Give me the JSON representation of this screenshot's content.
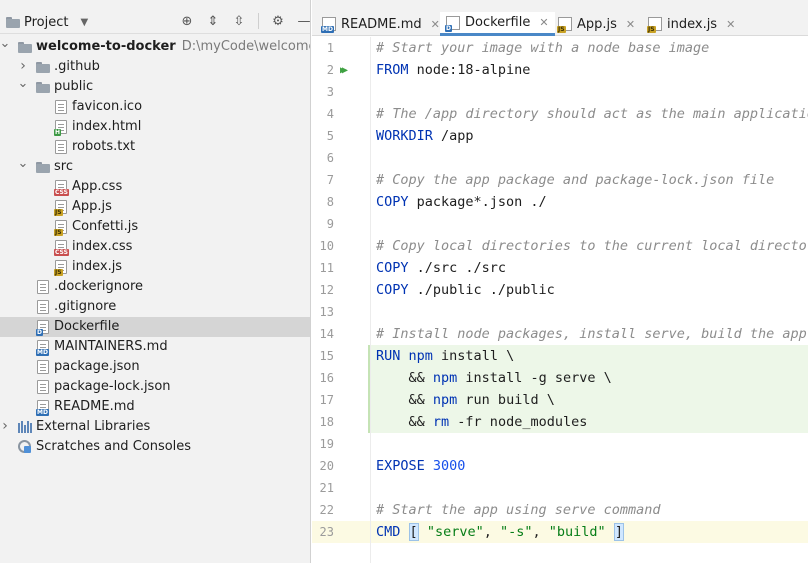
{
  "project_panel": {
    "title": "Project",
    "tree": [
      {
        "label": "welcome-to-docker",
        "path": "D:\\myCode\\welcome-t",
        "type": "folder",
        "depth": 0,
        "expanded": true,
        "bold": true
      },
      {
        "label": ".github",
        "type": "folder",
        "depth": 1,
        "expanded": false
      },
      {
        "label": "public",
        "type": "folder",
        "depth": 1,
        "expanded": true
      },
      {
        "label": "favicon.ico",
        "type": "file",
        "depth": 2,
        "badge": ""
      },
      {
        "label": "index.html",
        "type": "file",
        "depth": 2,
        "badge": "H"
      },
      {
        "label": "robots.txt",
        "type": "file",
        "depth": 2,
        "badge": ""
      },
      {
        "label": "src",
        "type": "folder",
        "depth": 1,
        "expanded": true
      },
      {
        "label": "App.css",
        "type": "file",
        "depth": 2,
        "badge": "CSS"
      },
      {
        "label": "App.js",
        "type": "file",
        "depth": 2,
        "badge": "JS"
      },
      {
        "label": "Confetti.js",
        "type": "file",
        "depth": 2,
        "badge": "JS"
      },
      {
        "label": "index.css",
        "type": "file",
        "depth": 2,
        "badge": "CSS"
      },
      {
        "label": "index.js",
        "type": "file",
        "depth": 2,
        "badge": "JS"
      },
      {
        "label": ".dockerignore",
        "type": "file",
        "depth": 1,
        "badge": ""
      },
      {
        "label": ".gitignore",
        "type": "file",
        "depth": 1,
        "badge": ""
      },
      {
        "label": "Dockerfile",
        "type": "file",
        "depth": 1,
        "badge": "D",
        "selected": true
      },
      {
        "label": "MAINTAINERS.md",
        "type": "file",
        "depth": 1,
        "badge": "MD"
      },
      {
        "label": "package.json",
        "type": "file",
        "depth": 1,
        "badge": ""
      },
      {
        "label": "package-lock.json",
        "type": "file",
        "depth": 1,
        "badge": ""
      },
      {
        "label": "README.md",
        "type": "file",
        "depth": 1,
        "badge": "MD"
      },
      {
        "label": "External Libraries",
        "type": "library",
        "depth": 0,
        "expanded": false
      },
      {
        "label": "Scratches and Consoles",
        "type": "scratch",
        "depth": 0
      }
    ]
  },
  "tabs": [
    {
      "label": "README.md",
      "badge": "MD",
      "active": false,
      "closable": true
    },
    {
      "label": "Dockerfile",
      "badge": "D",
      "active": true,
      "closable": true
    },
    {
      "label": "App.js",
      "badge": "JS",
      "active": false,
      "closable": true
    },
    {
      "label": "index.js",
      "badge": "JS",
      "active": false,
      "closable": true
    }
  ],
  "editor": {
    "lines": [
      {
        "n": "1",
        "tokens": [
          [
            "comment",
            "# Start your image with a node base image"
          ]
        ]
      },
      {
        "n": "2",
        "run": true,
        "tokens": [
          [
            "kw",
            "FROM"
          ],
          [
            "text",
            " node:18-alpine"
          ]
        ]
      },
      {
        "n": "3",
        "tokens": []
      },
      {
        "n": "4",
        "tokens": [
          [
            "comment",
            "# The /app directory should act as the main applicatio"
          ]
        ]
      },
      {
        "n": "5",
        "tokens": [
          [
            "kw",
            "WORKDIR"
          ],
          [
            "text",
            " /app"
          ]
        ]
      },
      {
        "n": "6",
        "tokens": []
      },
      {
        "n": "7",
        "tokens": [
          [
            "comment",
            "# Copy the app package and package-lock.json file"
          ]
        ]
      },
      {
        "n": "8",
        "tokens": [
          [
            "kw",
            "COPY"
          ],
          [
            "text",
            " package*.json ./"
          ]
        ]
      },
      {
        "n": "9",
        "tokens": []
      },
      {
        "n": "10",
        "tokens": [
          [
            "comment",
            "# Copy local directories to the current local director"
          ]
        ]
      },
      {
        "n": "11",
        "tokens": [
          [
            "kw",
            "COPY"
          ],
          [
            "text",
            " ./src ./src"
          ]
        ]
      },
      {
        "n": "12",
        "tokens": [
          [
            "kw",
            "COPY"
          ],
          [
            "text",
            " ./public ./public"
          ]
        ]
      },
      {
        "n": "13",
        "tokens": []
      },
      {
        "n": "14",
        "tokens": [
          [
            "comment",
            "# Install node packages, install serve, build the app,"
          ]
        ]
      },
      {
        "n": "15",
        "hl": "green",
        "tokens": [
          [
            "kw",
            "RUN"
          ],
          [
            "text",
            " "
          ],
          [
            "kw",
            "npm"
          ],
          [
            "text",
            " install \\"
          ]
        ]
      },
      {
        "n": "16",
        "hl": "green",
        "tokens": [
          [
            "text",
            "    && "
          ],
          [
            "kw",
            "npm"
          ],
          [
            "text",
            " install -g serve \\"
          ]
        ]
      },
      {
        "n": "17",
        "hl": "green",
        "tokens": [
          [
            "text",
            "    && "
          ],
          [
            "kw",
            "npm"
          ],
          [
            "text",
            " run build \\"
          ]
        ]
      },
      {
        "n": "18",
        "hl": "green",
        "tokens": [
          [
            "text",
            "    && "
          ],
          [
            "kw",
            "rm"
          ],
          [
            "text",
            " -fr node_modules"
          ]
        ]
      },
      {
        "n": "19",
        "tokens": []
      },
      {
        "n": "20",
        "tokens": [
          [
            "kw",
            "EXPOSE"
          ],
          [
            "text",
            " "
          ],
          [
            "num",
            "3000"
          ]
        ]
      },
      {
        "n": "21",
        "tokens": []
      },
      {
        "n": "22",
        "tokens": [
          [
            "comment",
            "# Start the app using serve command"
          ]
        ]
      },
      {
        "n": "23",
        "hl": "caret",
        "tokens": [
          [
            "kw",
            "CMD"
          ],
          [
            "text",
            " "
          ],
          [
            "bracket",
            "["
          ],
          [
            "text",
            " "
          ],
          [
            "str",
            "\"serve\""
          ],
          [
            "text",
            ", "
          ],
          [
            "str",
            "\"-s\""
          ],
          [
            "text",
            ", "
          ],
          [
            "str",
            "\"build\""
          ],
          [
            "text",
            " "
          ],
          [
            "bracket",
            "]"
          ]
        ]
      }
    ]
  },
  "colors": {
    "keyword": "#0033b3",
    "comment": "#8c8c8c",
    "string": "#067d17",
    "number": "#1750eb",
    "selection": "#d5d5d5",
    "tab_underline": "#4a88c7",
    "changed_line": "#edf7e8",
    "caret_line": "#fcfae3"
  }
}
